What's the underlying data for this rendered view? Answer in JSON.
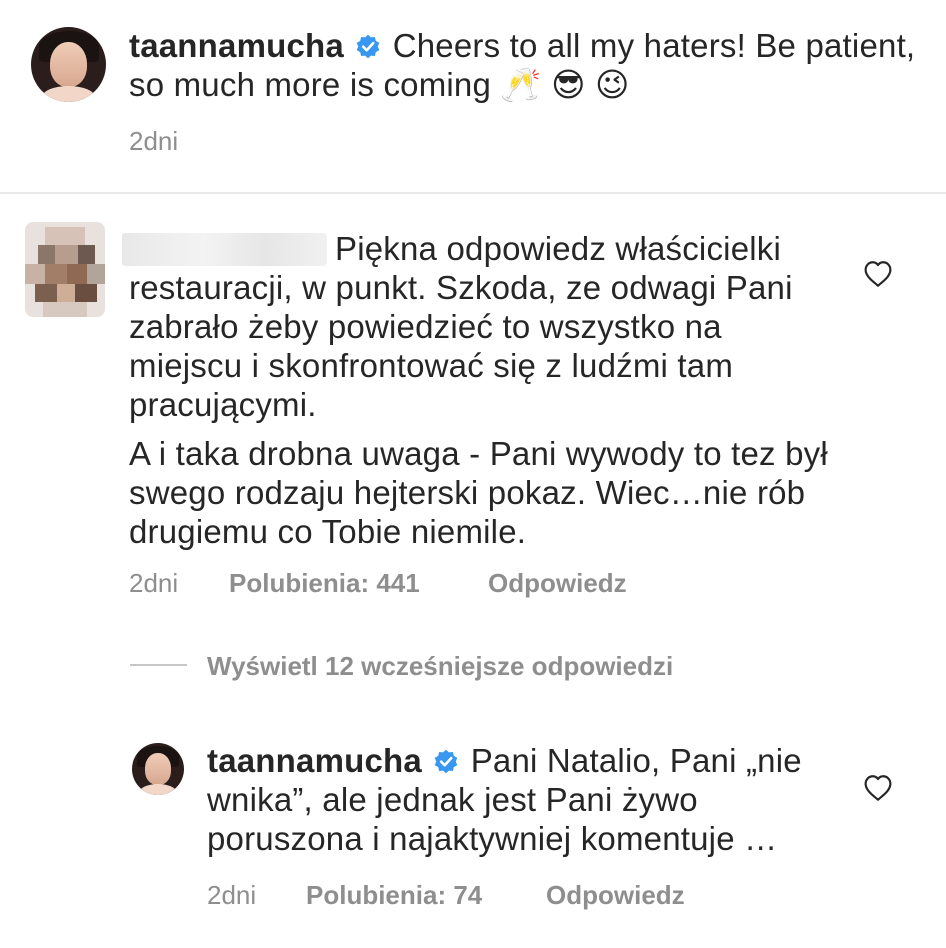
{
  "caption": {
    "username": "taannamucha",
    "text": "Cheers to all my haters! Be patient, so much more is coming",
    "emojis": "🥂 😎 😉",
    "time": "2dni"
  },
  "comment": {
    "paragraph1": "Piękna odpowiedz właścicielki restauracji, w punkt. Szkoda, ze odwagi Pani zabrało żeby powiedzieć to wszystko na miejscu i skonfrontować się z ludźmi tam pracującymi.",
    "paragraph2": "A i taka drobna uwaga - Pani wywody to tez był swego rodzaju hejterski pokaz. Wiec…nie rób drugiemu co Tobie niemile.",
    "time": "2dni",
    "likes": "Polubienia: 441",
    "reply": "Odpowiedz"
  },
  "view_replies": "Wyświetl 12 wcześniejsze odpowiedzi",
  "reply": {
    "username": "taannamucha",
    "text": "Pani Natalio, Pani „nie wnika”, ale jednak jest Pani żywo poruszona i najaktywniej komentuje …",
    "time": "2dni",
    "likes": "Polubienia: 74",
    "reply": "Odpowiedz"
  },
  "colors": {
    "text": "#262626",
    "secondary": "#8e8e8e",
    "verified": "#3897f0"
  },
  "icons": [
    "verified-badge-icon",
    "heart-outline-icon"
  ]
}
